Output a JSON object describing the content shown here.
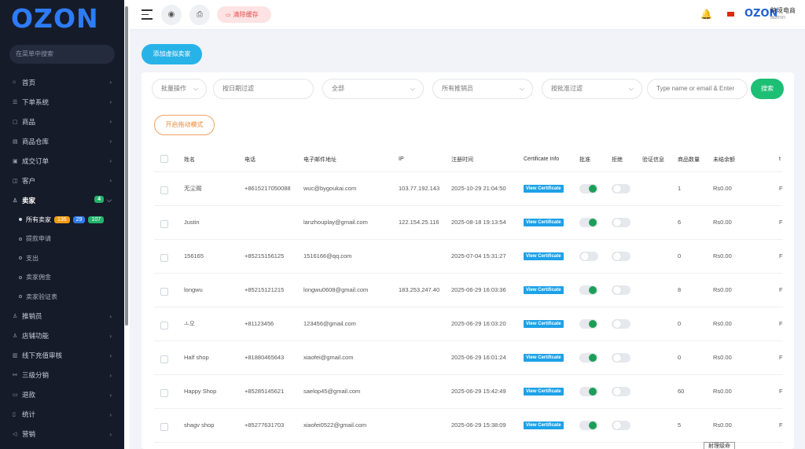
{
  "sidebar": {
    "logo": "OZON",
    "search_placeholder": "在菜单中搜索",
    "menu": [
      {
        "icon": "home-icon",
        "glyph": "⌂",
        "label": "首页",
        "chev": false
      },
      {
        "icon": "order-system-icon",
        "glyph": "☰",
        "label": "下单系统",
        "chev": true
      },
      {
        "icon": "product-icon",
        "glyph": "▢",
        "label": "商品",
        "chev": true
      },
      {
        "icon": "warehouse-icon",
        "glyph": "▤",
        "label": "商品仓库",
        "chev": true
      },
      {
        "icon": "deal-order-icon",
        "glyph": "▣",
        "label": "成交订单",
        "chev": true
      },
      {
        "icon": "customer-icon",
        "glyph": "◫",
        "label": "客户",
        "chev": true
      }
    ],
    "seller": {
      "label": "卖家",
      "badge": "4"
    },
    "seller_sub": [
      {
        "label": "所有卖家",
        "badges": [
          "136",
          "29",
          "107"
        ],
        "active": true
      },
      {
        "label": "提款申请"
      },
      {
        "label": "支出"
      },
      {
        "label": "卖家佣金"
      },
      {
        "label": "卖家验证表"
      }
    ],
    "menu2": [
      {
        "icon": "promoter-icon",
        "glyph": "♙",
        "label": "推销员"
      },
      {
        "icon": "store-function-icon",
        "glyph": "♙",
        "label": "店铺功能"
      },
      {
        "icon": "offline-recharge-icon",
        "glyph": "▥",
        "label": "线下充值审核"
      },
      {
        "icon": "distribution-icon",
        "glyph": "⚯",
        "label": "三级分销"
      },
      {
        "icon": "refund-icon",
        "glyph": "▭",
        "label": "退款"
      },
      {
        "icon": "statistics-icon",
        "glyph": "▯",
        "label": "统计"
      },
      {
        "icon": "marketing-icon",
        "glyph": "◁",
        "label": "营销"
      }
    ],
    "badge_colors": [
      "#f39c12",
      "#2f7be6",
      "#22b36b"
    ]
  },
  "header": {
    "clear_cache": "清除缓存",
    "brand_logo": "OZON",
    "brand_name": "跨境电商",
    "brand_role": "admin"
  },
  "toolbar": {
    "add_virtual_seller": "添加虚拟卖家",
    "bulk_ops": "批量操作",
    "date_filter_placeholder": "按日期过滤",
    "all": "全部",
    "all_promoters": "所有推销员",
    "approval_filter": "按批准过滤",
    "search_placeholder": "Type name or email & Enter",
    "search_btn": "搜索",
    "drag_mode": "开启拖动模式"
  },
  "table": {
    "headers": [
      "姓名",
      "电话",
      "电子邮件地址",
      "IP",
      "注册时间",
      "Certificate Info",
      "批准",
      "拒绝",
      "验证信息",
      "商品数量",
      "未结余额",
      "t"
    ],
    "cert_label": "View Certificate",
    "rows": [
      {
        "name": "无尘阁",
        "phone": "+8615217050088",
        "email": "wuc@bygoukai.com",
        "ip": "103.77.192.143",
        "time": "2025-10-29 21:04:50",
        "approve": true,
        "goods": "1",
        "balance": "Rs0.00"
      },
      {
        "name": "Justin",
        "phone": "",
        "email": "lanzhouplay@gmail.com",
        "ip": "122.154.25.116",
        "time": "2025-08-18 19:13:54",
        "approve": true,
        "goods": "6",
        "balance": "Rs0.00"
      },
      {
        "name": "156165",
        "phone": "+85215156125",
        "email": "1516166@qq.com",
        "ip": "",
        "time": "2025-07-04 15:31:27",
        "approve": false,
        "goods": "0",
        "balance": "Rs0.00"
      },
      {
        "name": "longwu",
        "phone": "+85215121215",
        "email": "longwu0608@gmail.com",
        "ip": "183.253.247.40",
        "time": "2025-06-29 16:03:36",
        "approve": true,
        "goods": "8",
        "balance": "Rs0.00"
      },
      {
        "name": "ㅗ오",
        "phone": "+81123456",
        "email": "123456@gmail.com",
        "ip": "",
        "time": "2025-06-29 16:03:20",
        "approve": true,
        "goods": "0",
        "balance": "Rs0.00"
      },
      {
        "name": "Half shop",
        "phone": "+81880465643",
        "email": "xiaofei@gmail.com",
        "ip": "",
        "time": "2025-06-29 16:01:24",
        "approve": true,
        "goods": "0",
        "balance": "Rs0.00"
      },
      {
        "name": "Happy Shop",
        "phone": "+85285145621",
        "email": "saelop45@gmail.com",
        "ip": "",
        "time": "2025-06-29 15:42:49",
        "approve": true,
        "goods": "60",
        "balance": "Rs0.00"
      },
      {
        "name": "shagv shop",
        "phone": "+85277631703",
        "email": "xiaofei0522@gmail.com",
        "ip": "",
        "time": "2025-06-29 15:38:09",
        "approve": true,
        "goods": "5",
        "balance": "Rs0.00"
      }
    ],
    "last_col": "F"
  },
  "tooltip": "射理级命"
}
